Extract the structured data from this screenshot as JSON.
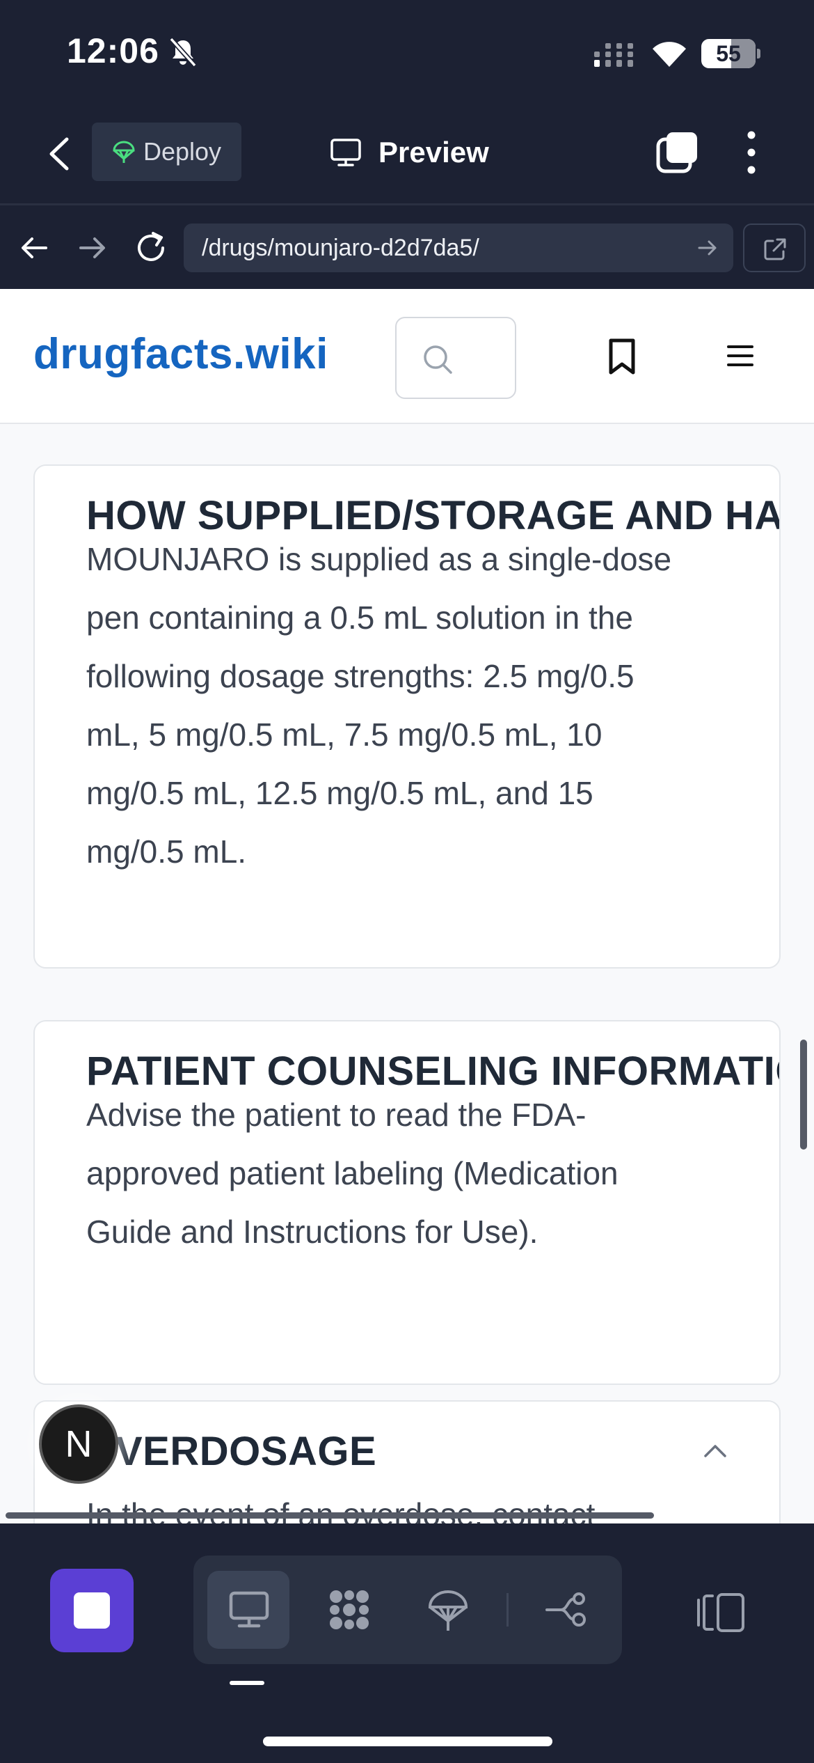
{
  "status_bar": {
    "time": "12:06",
    "battery": "55",
    "battery_fraction": 0.55
  },
  "toolbar": {
    "deploy_label": "Deploy",
    "preview_label": "Preview"
  },
  "url_bar": {
    "url": "/drugs/mounjaro-d2d7da5/"
  },
  "site": {
    "logo": "drugfacts.wiki"
  },
  "sections": [
    {
      "title": "HOW SUPPLIED/STORAGE AND HANDLING",
      "lines": [
        "MOUNJARO is supplied as a single-dose",
        "pen containing a 0.5 mL solution in the",
        "following dosage strengths: 2.5 mg/0.5",
        "mL, 5 mg/0.5 mL, 7.5 mg/0.5 mL, 10",
        "mg/0.5 mL, 12.5 mg/0.5 mL, and 15",
        "mg/0.5 mL."
      ]
    },
    {
      "title": "PATIENT COUNSELING INFORMATION",
      "lines": [
        "Advise the patient to read the FDA-",
        "approved patient labeling (Medication",
        "Guide and Instructions for Use)."
      ]
    },
    {
      "title": "VERDOSAGE",
      "lines": [
        "In the event of an overdose, contact"
      ]
    }
  ],
  "dev_badge": "N",
  "colors": {
    "chrome_background": "#1c2133",
    "logo_blue": "#1565c0",
    "stop_button": "#5b3fd4"
  },
  "icons": {
    "status": [
      "bell-off-icon",
      "cellular-signal-icon",
      "wifi-icon",
      "battery-icon"
    ],
    "toolbar": [
      "back-chevron-icon",
      "deploy-icon",
      "monitor-icon",
      "tabs-icon",
      "more-vertical-icon"
    ],
    "url_bar": [
      "arrow-left-icon",
      "arrow-right-icon",
      "reload-icon",
      "go-arrow-icon",
      "open-external-icon"
    ],
    "site": [
      "search-icon",
      "bookmark-icon",
      "menu-icon"
    ],
    "dock": [
      "stop-icon",
      "monitor-icon",
      "apps-grid-icon",
      "deploy-icon",
      "workflow-icon",
      "panel-toggle-icon"
    ]
  }
}
